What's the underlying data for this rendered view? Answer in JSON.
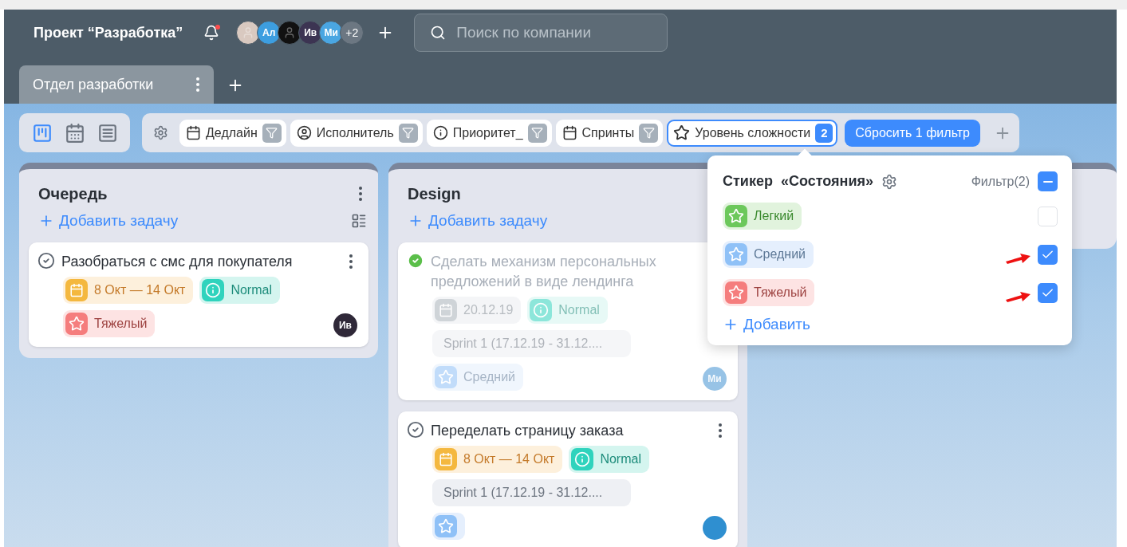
{
  "header": {
    "title": "Проект “Разработка”",
    "notification": true,
    "avatars": [
      {
        "kind": "photo",
        "color": "#d9c9c0"
      },
      {
        "kind": "initials",
        "initials": "Ал",
        "color": "#3d9ee0"
      },
      {
        "kind": "photo",
        "color": "#111111"
      },
      {
        "kind": "initials",
        "initials": "Ив",
        "color": "#3c3452"
      },
      {
        "kind": "initials",
        "initials": "Ми",
        "color": "#4aa6e2"
      },
      {
        "kind": "more",
        "initials": "+2",
        "color": "#6c7782"
      }
    ],
    "search": {
      "placeholder": "Поиск по компании"
    }
  },
  "tabs": [
    {
      "label": "Отдел разработки",
      "selected": true
    }
  ],
  "views": [
    {
      "kind": "board",
      "selected": true
    },
    {
      "kind": "calendar",
      "selected": false
    },
    {
      "kind": "list",
      "selected": false
    }
  ],
  "filters": [
    {
      "kind": "deadline",
      "label": "Дедлайн",
      "active": false
    },
    {
      "kind": "assignee",
      "label": "Исполнитель",
      "active": false
    },
    {
      "kind": "priority",
      "label": "Приоритет_",
      "active": false
    },
    {
      "kind": "sprint",
      "label": "Спринты",
      "active": false
    },
    {
      "kind": "difficulty",
      "label": "Уровень сложности",
      "active": true,
      "count": "2"
    }
  ],
  "reset_button": "Сбросить 1 фильтр",
  "popover": {
    "title": "Стикер",
    "quote": "«Состояния»",
    "filter_label": "Фильтр(2)",
    "select_all": {
      "checked": true,
      "mixed": true
    },
    "items": [
      {
        "kind": "easy",
        "label": "Легкий",
        "checked": false,
        "annotated": false
      },
      {
        "kind": "medium",
        "label": "Средний",
        "checked": true,
        "annotated": true
      },
      {
        "kind": "hard",
        "label": "Тяжелый",
        "checked": true,
        "annotated": true
      }
    ],
    "add": "Добавить"
  },
  "columns": [
    {
      "title": "Очередь",
      "add": "Добавить задачу",
      "cards": [
        {
          "title": "Разобраться с смс для покупателя",
          "done": false,
          "menu": true,
          "tags": [
            {
              "kind": "date",
              "label": "8 Окт — 14 Окт"
            },
            {
              "kind": "priority",
              "label": "Normal"
            },
            {
              "kind": "hard",
              "label": "Тяжелый"
            }
          ],
          "assignee": {
            "initials": "Ив",
            "color": "#2f2838"
          }
        }
      ]
    },
    {
      "title": "Design",
      "add": "Добавить задачу",
      "cards": [
        {
          "title": "Сделать механизм персональных предложений в виде лендинга",
          "done": true,
          "menu": false,
          "tags": [
            {
              "kind": "date",
              "label": "20.12.19"
            },
            {
              "kind": "priority",
              "label": "Normal"
            },
            {
              "kind": "sprint",
              "label": "Sprint 1 (17.12.19 - 31.12...."
            },
            {
              "kind": "medium",
              "label": "Средний"
            }
          ],
          "assignee": {
            "initials": "Ми",
            "color": "#97c3e6"
          }
        },
        {
          "title": "Переделать страницу заказа",
          "done": false,
          "menu": true,
          "tags": [
            {
              "kind": "date",
              "label": "8 Окт — 14 Окт"
            },
            {
              "kind": "priority",
              "label": "Normal"
            },
            {
              "kind": "sprint",
              "label": "Sprint 1 (17.12.19 - 31.12...."
            },
            {
              "kind": "medium"
            }
          ],
          "assignee": {
            "color": "#2f8fd0"
          }
        }
      ]
    }
  ]
}
